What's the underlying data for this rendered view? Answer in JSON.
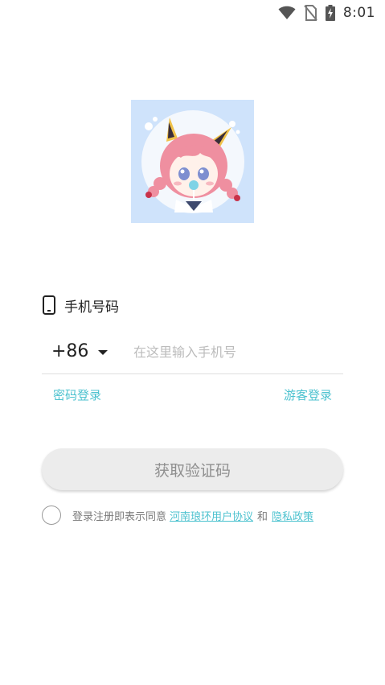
{
  "status_bar": {
    "time": "8:01",
    "icons": [
      "wifi-icon",
      "no-sim-icon",
      "battery-charging-icon"
    ]
  },
  "avatar": {
    "icon": "anime-girl-avatar"
  },
  "form": {
    "phone_label": "手机号码",
    "phone_label_icon": "phone-icon",
    "country_code": "+86",
    "country_caret_icon": "caret-down-icon",
    "phone_placeholder": "在这里输入手机号",
    "password_login": "密码登录",
    "guest_login": "游客登录",
    "get_code_button": "获取验证码"
  },
  "agreement": {
    "prefix": "登录注册即表示同意",
    "user_agreement": "河南琅环用户协议",
    "and": "和",
    "privacy_policy": "隐私政策"
  },
  "colors": {
    "accent": "#4cc2cf",
    "button_bg": "#ececec",
    "avatar_bg": "#cfe3fb"
  }
}
